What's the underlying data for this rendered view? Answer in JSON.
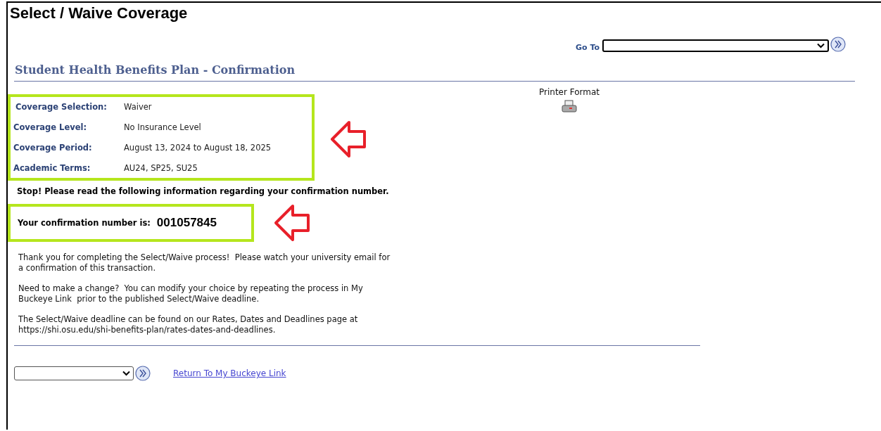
{
  "page_title": "Select / Waive Coverage",
  "goto": {
    "label": "Go To"
  },
  "section_title": "Student Health Benefits Plan - Confirmation",
  "printer": {
    "label": "Printer Format"
  },
  "coverage": [
    {
      "label": "Coverage Selection:",
      "value": "Waiver"
    },
    {
      "label": "Coverage Level:",
      "value": "No Insurance Level"
    },
    {
      "label": "Coverage Period:",
      "value": "August 13, 2024 to August 18, 2025"
    },
    {
      "label": "Academic Terms:",
      "value": "AU24, SP25, SU25"
    }
  ],
  "notice": "Stop! Please read the following information regarding your confirmation number.",
  "confirmation": {
    "label": "Your confirmation number is:",
    "number": "001057845"
  },
  "paragraphs": [
    "Thank you for completing the Select/Waive process!  Please watch your university email for\na confirmation of this transaction.",
    "Need to make a change?  You can modify your choice by repeating the process in My\nBuckeye Link  prior to the published Select/Waive deadline.",
    "The Select/Waive deadline can be found on our Rates, Dates and Deadlines page at\nhttps://shi.osu.edu/shi-benefits-plan/rates-dates-and-deadlines."
  ],
  "return_link": "Return To My Buckeye Link"
}
